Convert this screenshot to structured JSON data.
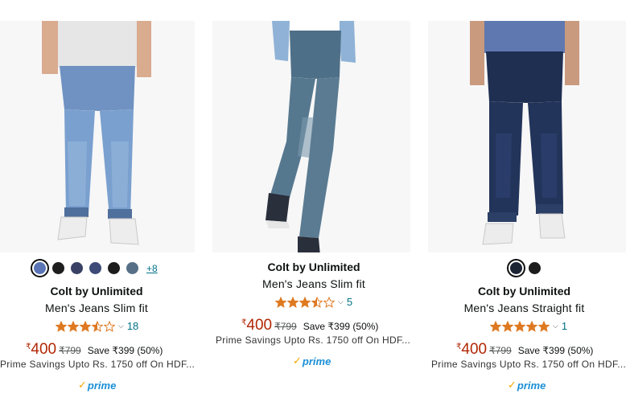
{
  "products": [
    {
      "brand": "Colt by Unlimited",
      "title": "Men's Jeans Slim fit",
      "rating": 3.5,
      "reviews": "18",
      "currency": "₹",
      "price": "400",
      "mrp": "₹799",
      "save": "Save ₹399 (50%)",
      "prime_savings": "Prime Savings Upto Rs. 1750 off On HDF...",
      "prime_label": "prime",
      "swatches": [
        "#5a74b5",
        "#1e1e1e",
        "#394266",
        "#3e4b78",
        "#1c1c1c",
        "#577088"
      ],
      "more_colors": "+8"
    },
    {
      "brand": "Colt by Unlimited",
      "title": "Men's Jeans Slim fit",
      "rating": 3.5,
      "reviews": "5",
      "currency": "₹",
      "price": "400",
      "mrp": "₹799",
      "save": "Save ₹399 (50%)",
      "prime_savings": "Prime Savings Upto Rs. 1750 off On HDF...",
      "prime_label": "prime"
    },
    {
      "brand": "Colt by Unlimited",
      "title": "Men's Jeans Straight fit",
      "rating": 5,
      "reviews": "1",
      "currency": "₹",
      "price": "400",
      "mrp": "₹799",
      "save": "Save ₹399 (50%)",
      "prime_savings": "Prime Savings Upto Rs. 1750 off On HDF...",
      "prime_label": "prime",
      "swatches": [
        "#1c2533",
        "#1c1c1c"
      ]
    }
  ],
  "colors": {
    "star": "#de7921",
    "price": "#b12704",
    "link": "#007185",
    "prime_blue": "#1a8fd6",
    "prime_check": "#f7a600"
  }
}
